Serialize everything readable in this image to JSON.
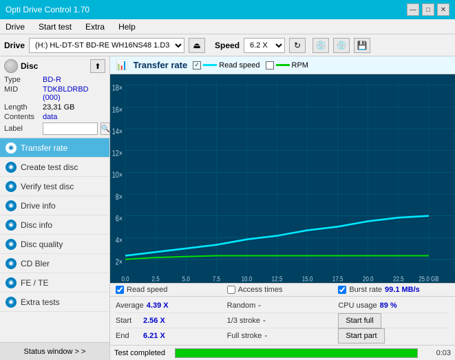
{
  "titlebar": {
    "title": "Opti Drive Control 1.70",
    "minimize": "—",
    "maximize": "□",
    "close": "✕"
  },
  "menubar": {
    "items": [
      "Drive",
      "Start test",
      "Extra",
      "Help"
    ]
  },
  "drivebar": {
    "label": "Drive",
    "drive_value": "(H:)  HL-DT-ST BD-RE  WH16NS48 1.D3",
    "speed_label": "Speed",
    "speed_value": "6.2 X"
  },
  "disc": {
    "title": "Disc",
    "type_label": "Type",
    "type_value": "BD-R",
    "mid_label": "MID",
    "mid_value": "TDKBLDRBD (000)",
    "length_label": "Length",
    "length_value": "23,31 GB",
    "contents_label": "Contents",
    "contents_value": "data",
    "label_label": "Label",
    "label_placeholder": ""
  },
  "nav": {
    "items": [
      {
        "label": "Transfer rate",
        "active": true
      },
      {
        "label": "Create test disc",
        "active": false
      },
      {
        "label": "Verify test disc",
        "active": false
      },
      {
        "label": "Drive info",
        "active": false
      },
      {
        "label": "Disc info",
        "active": false
      },
      {
        "label": "Disc quality",
        "active": false
      },
      {
        "label": "CD Bler",
        "active": false
      },
      {
        "label": "FE / TE",
        "active": false
      },
      {
        "label": "Extra tests",
        "active": false
      }
    ],
    "status_window": "Status window > >"
  },
  "chart": {
    "title": "Transfer rate",
    "legend_read": "Read speed",
    "legend_rpm": "RPM",
    "y_labels": [
      "18×",
      "16×",
      "14×",
      "12×",
      "10×",
      "8×",
      "6×",
      "4×",
      "2×"
    ],
    "x_labels": [
      "0.0",
      "2.5",
      "5.0",
      "7.5",
      "10.0",
      "12.5",
      "15.0",
      "17.5",
      "20.0",
      "22.5",
      "25.0 GB"
    ]
  },
  "stats": {
    "read_speed_label": "Read speed",
    "access_times_label": "Access times",
    "burst_rate_label": "Burst rate",
    "burst_rate_value": "99.1 MB/s"
  },
  "details": {
    "row1": {
      "key1": "Average",
      "val1": "4.39 X",
      "key2": "Random",
      "val2": "-",
      "key3": "CPU usage",
      "val3": "89 %"
    },
    "row2": {
      "key1": "Start",
      "val1": "2.56 X",
      "key2": "1/3 stroke",
      "val2": "-",
      "btn": "Start full"
    },
    "row3": {
      "key1": "End",
      "val1": "6.21 X",
      "key2": "Full stroke",
      "val2": "-",
      "btn": "Start part"
    }
  },
  "statusbar": {
    "text": "Test completed",
    "progress": 100,
    "time": "0:03"
  }
}
